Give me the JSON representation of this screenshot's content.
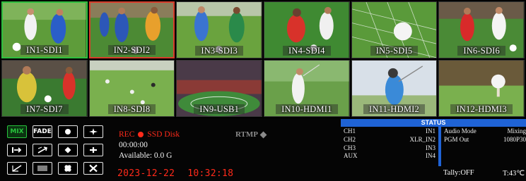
{
  "tiles": [
    {
      "label": "IN1-SDI1"
    },
    {
      "label": "IN2-SDI2"
    },
    {
      "label": "IN3-SDI3"
    },
    {
      "label": "IN4-SDI4"
    },
    {
      "label": "IN5-SDI5"
    },
    {
      "label": "IN6-SDI6"
    },
    {
      "label": "IN7-SDI7"
    },
    {
      "label": "IN8-SDI8"
    },
    {
      "label": "IN9-USB1"
    },
    {
      "label": "IN10-HDMI1"
    },
    {
      "label": "IN11-HDMI2"
    },
    {
      "label": "IN12-HDMI3"
    }
  ],
  "transitions": {
    "mix_label": "MIX",
    "fade_label": "FADE",
    "wipe_icons": [
      "circle-wipe-icon",
      "star-wipe-icon",
      "bar-right-wipe-icon",
      "diagonal-wipe-icon",
      "diamond-wipe-icon",
      "cross-wipe-icon",
      "slash-wipe-icon",
      "blinds-wipe-icon",
      "clover-wipe-icon",
      "x-wipe-icon"
    ]
  },
  "record": {
    "rec_label": "REC",
    "disk_label": "SSD Disk",
    "duration": "00:00:00",
    "available": "Available: 0.0  G"
  },
  "datetime": {
    "date": "2023-12-22",
    "time": "10:32:18"
  },
  "rtmp": {
    "label": "RTMP"
  },
  "status": {
    "title": "STATUS",
    "channels": [
      {
        "name": "CH1",
        "source": "IN1"
      },
      {
        "name": "CH2",
        "source": "XLR_IN2"
      },
      {
        "name": "CH3",
        "source": "IN3"
      },
      {
        "name": "AUX",
        "source": "IN4"
      }
    ],
    "audio_mode_label": "Audio Mode",
    "audio_mode_value": "Mixing",
    "pgm_out_label": "PGM Out",
    "pgm_out_value": "1080P30",
    "tally": "Tally:OFF",
    "temperature": "T:43℃"
  },
  "colors": {
    "preview": "#2fbf3f",
    "program": "#d83c2a",
    "status_blue": "#1f63d6",
    "rec_red": "#ff2a1a"
  }
}
